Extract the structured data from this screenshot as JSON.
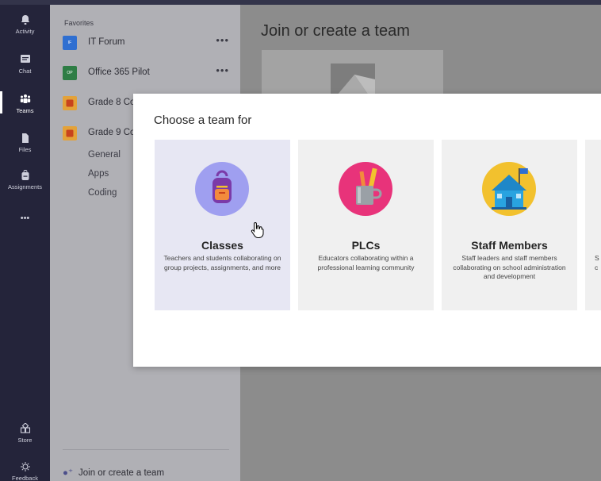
{
  "rail": {
    "items": [
      {
        "label": "Activity",
        "icon": "bell-icon"
      },
      {
        "label": "Chat",
        "icon": "chat-icon"
      },
      {
        "label": "Teams",
        "icon": "teams-icon"
      },
      {
        "label": "Files",
        "icon": "file-icon"
      },
      {
        "label": "Assignments",
        "icon": "backpack-icon"
      },
      {
        "label": "•••",
        "icon": "more-icon"
      },
      {
        "label": "Store",
        "icon": "store-icon"
      },
      {
        "label": "Feedback",
        "icon": "feedback-icon"
      }
    ],
    "active": "Teams"
  },
  "teams_panel": {
    "favorites_label": "Favorites",
    "teams": [
      {
        "name": "IT Forum",
        "initials": "IF",
        "color": "#2f6fd1",
        "more": "•••"
      },
      {
        "name": "Office 365 Pilot",
        "initials": "OP",
        "color": "#2e7d45",
        "more": "•••"
      },
      {
        "name": "Grade 8 Co",
        "initials": "",
        "color": "#e3a23a"
      },
      {
        "name": "Grade 9 Co",
        "initials": "",
        "color": "#e3a23a"
      }
    ],
    "channels": [
      "General",
      "Apps",
      "Coding"
    ],
    "join_label": "Join or create a team"
  },
  "main": {
    "title": "Join or create a team"
  },
  "modal": {
    "title": "Choose a team for",
    "tiles": [
      {
        "name": "Classes",
        "desc": "Teachers and students collaborating on group projects, assignments, and more",
        "icon": "backpack-icon",
        "icon_bg": "#9f9ff0"
      },
      {
        "name": "PLCs",
        "desc": "Educators collaborating within a professional learning community",
        "icon": "pencil-cup-icon",
        "icon_bg": "#e8337a"
      },
      {
        "name": "Staff Members",
        "desc": "Staff leaders and staff members collaborating on school administration and development",
        "icon": "school-house-icon",
        "icon_bg": "#f2c12e"
      },
      {
        "name": "",
        "desc_lines": [
          "S",
          "c"
        ]
      }
    ]
  }
}
